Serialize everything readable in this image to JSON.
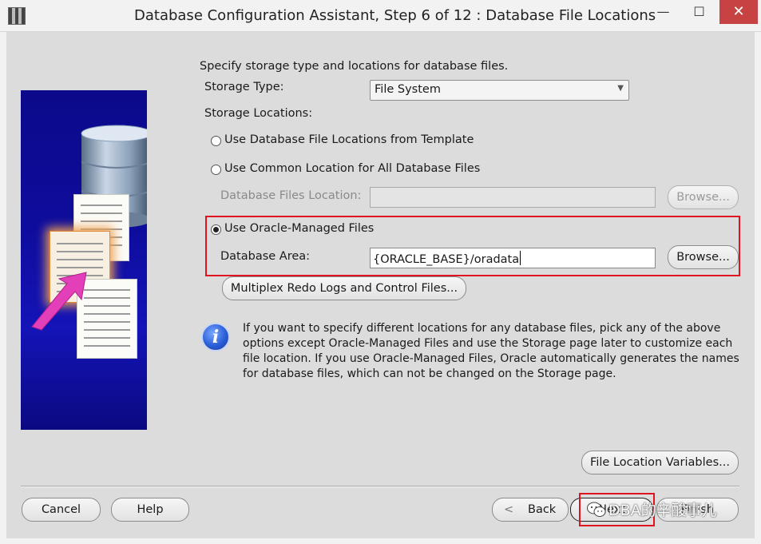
{
  "window": {
    "title": "Database Configuration Assistant, Step 6 of 12 : Database File Locations",
    "minimize": "—",
    "maximize": "☐",
    "close": "✕"
  },
  "intro": "Specify storage type and locations for database files.",
  "storage_type": {
    "label": "Storage Type:",
    "value": "File System"
  },
  "storage_locations": {
    "label": "Storage Locations:",
    "options": [
      {
        "label": "Use Database File Locations from Template",
        "checked": false
      },
      {
        "label": "Use Common Location for All Database Files",
        "checked": false
      },
      {
        "label": "Use Oracle-Managed Files",
        "checked": true
      }
    ]
  },
  "db_files_location": {
    "label": "Database Files Location:",
    "value": "",
    "browse": "Browse..."
  },
  "db_area": {
    "label": "Database Area:",
    "value": "{ORACLE_BASE}/oradata",
    "browse": "Browse..."
  },
  "multiplex_button": "Multiplex Redo Logs and Control Files...",
  "info_message": "If you want to specify different locations for any database files, pick any of the above options except Oracle-Managed Files and use the Storage page later to customize each file location. If you use Oracle-Managed Files, Oracle automatically generates the names for database files, which can not be changed on the Storage page.",
  "file_location_variables_button": "File Location Variables...",
  "footer": {
    "cancel": "Cancel",
    "help": "Help",
    "back": "Back",
    "next": "Next",
    "finish": "Finish"
  },
  "watermark": "DBA的辛酸事儿",
  "colors": {
    "highlight_box": "#e0141e",
    "panel_background": "#dcdcdc",
    "side_image": "#0e0c9c"
  }
}
